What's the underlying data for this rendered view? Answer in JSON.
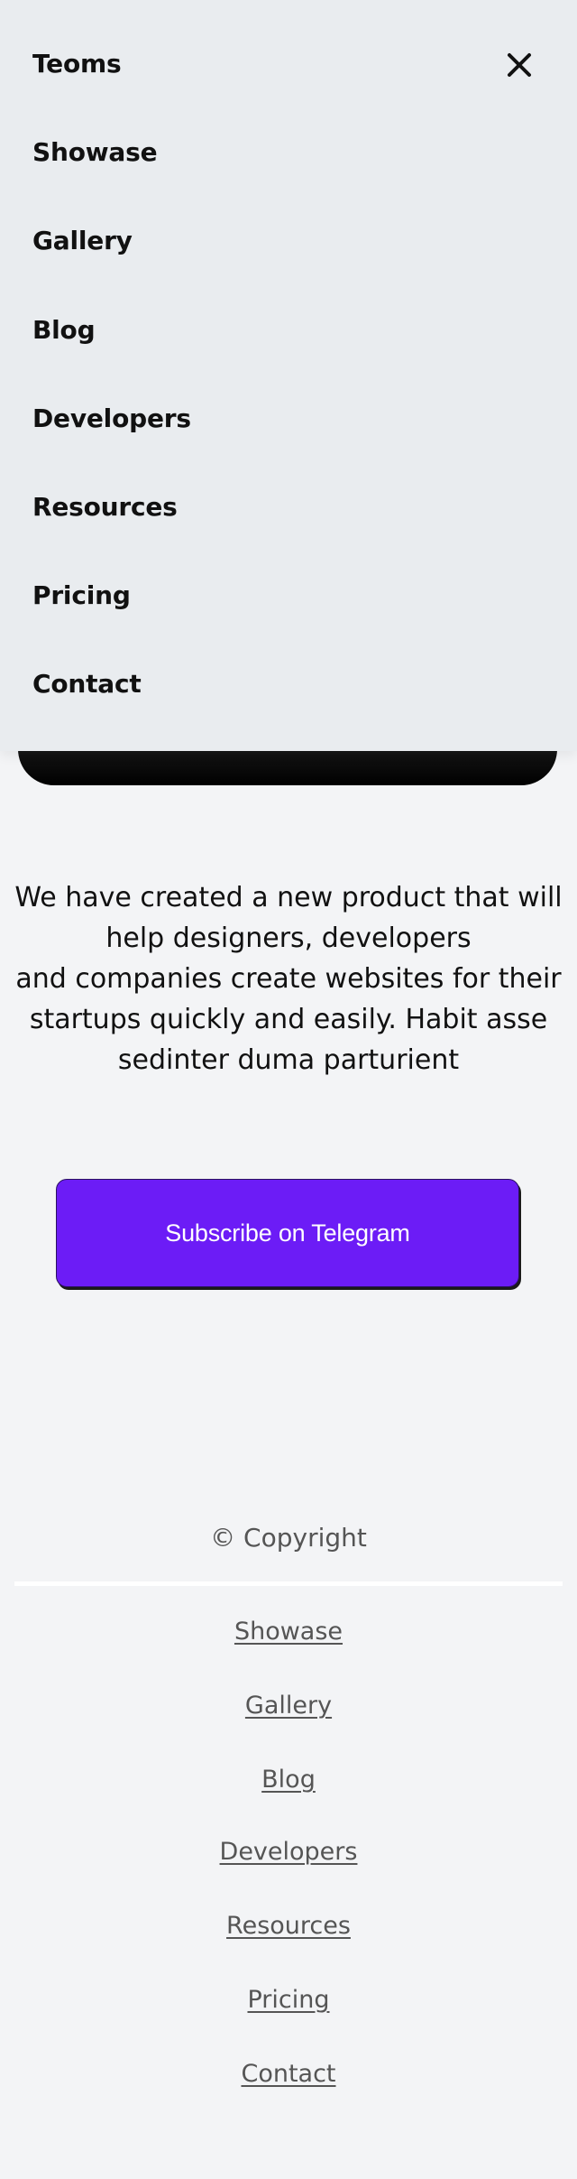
{
  "menu": {
    "brand": "Teoms",
    "close_icon": "close-icon",
    "items": [
      {
        "label": "Showase"
      },
      {
        "label": "Gallery"
      },
      {
        "label": "Blog"
      },
      {
        "label": "Developers"
      },
      {
        "label": "Resources"
      },
      {
        "label": "Pricing"
      },
      {
        "label": "Contact"
      }
    ]
  },
  "main": {
    "description_lines": [
      "We have created a new product that will",
      "help designers, developers",
      "and companies create websites for their",
      "startups quickly and easily. Habit asse",
      "sedinter duma parturient"
    ],
    "cta_label": "Subscribe on Telegram",
    "cta_color": "#6c1cf6"
  },
  "footer": {
    "copyright": "© Copyright",
    "links": [
      {
        "label": "Showase"
      },
      {
        "label": "Gallery"
      },
      {
        "label": "Blog"
      },
      {
        "label": "Developers"
      },
      {
        "label": "Resources"
      },
      {
        "label": "Pricing"
      },
      {
        "label": "Contact"
      }
    ]
  }
}
